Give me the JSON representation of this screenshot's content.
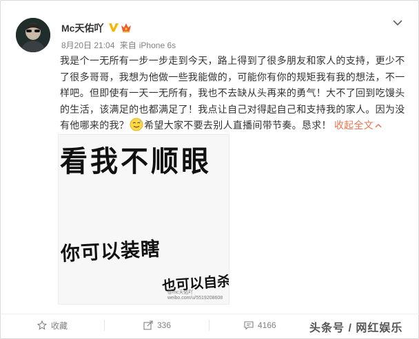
{
  "user": {
    "name": "Mc天佑吖",
    "avatar_icon": "user-avatar-icon"
  },
  "meta": {
    "date": "8月20日 21:04",
    "source_prefix": "来自",
    "source": "iPhone 6s"
  },
  "post": {
    "text_part1": "我是个一无所有一步一步走到今天，路上得到了很多朋友和家人的支持，更少不了很多哥哥，我想为他做一些我能做的，可能你有你的规矩我有我的想法，不一样吧。但即使有一天一无所有，我也不去缺从头再来的勇气！大不了回到吃馒头的生活，该满足的也都满足了！我点让自己对得起自己和支持我的家人。因为没有他哪来的我？",
    "text_part2": "希望大家不要去别人直播间带节奏。恳求！",
    "collapse_label": "收起全文",
    "emoji_icon": "sweat-smile-emoji-icon"
  },
  "image": {
    "line1": "看我不顺眼",
    "line2": "你可以装瞎",
    "line3": "也可以自杀",
    "watermark_line1": "@mc天佑吖",
    "watermark_line2": "weibo.com/u/5519208608"
  },
  "actions": {
    "favorite_label": "收藏",
    "share_count": "336",
    "comment_count": "4166"
  },
  "brand": {
    "text": "头条号 / 网红娱乐"
  },
  "colors": {
    "accent": "#eb7350",
    "muted": "#808080",
    "verified": "#f7b500"
  }
}
